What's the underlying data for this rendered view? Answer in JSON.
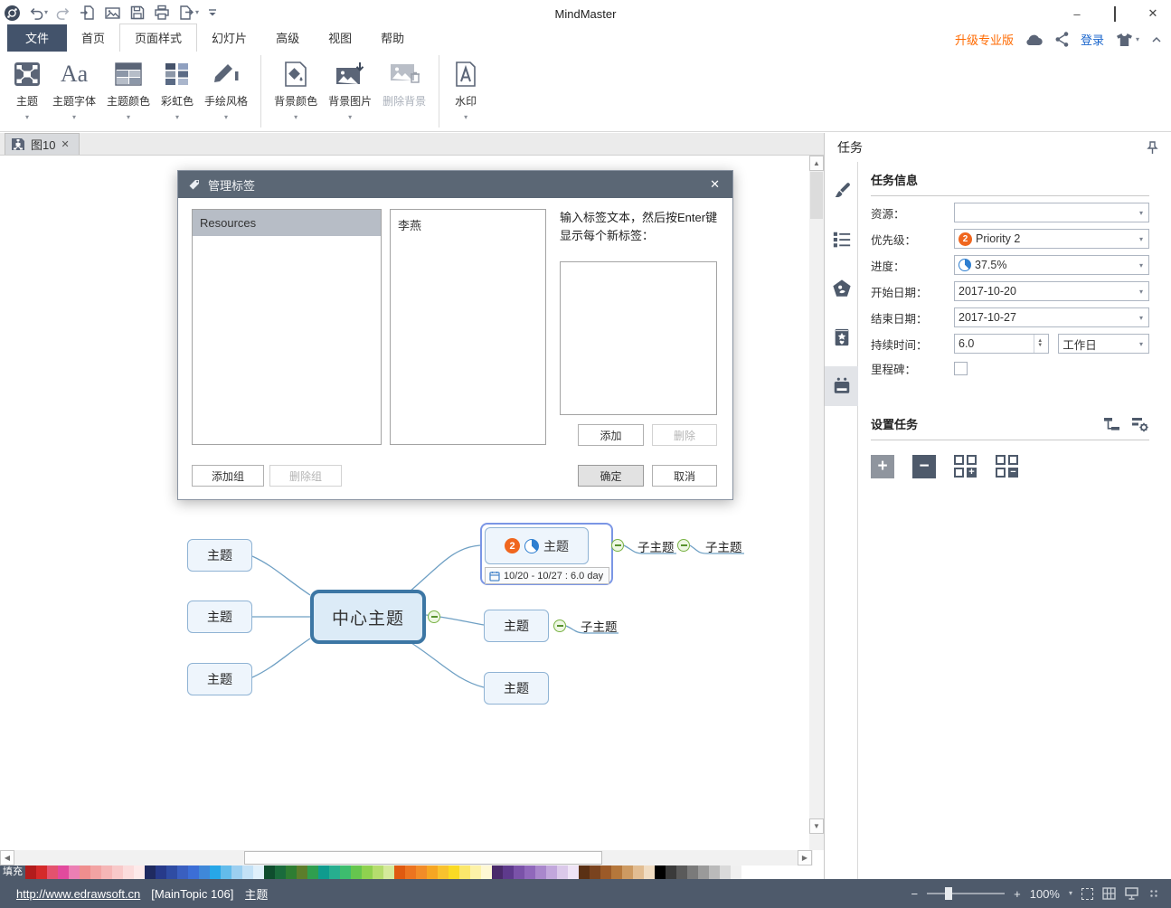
{
  "titlebar": {
    "title": "MindMaster"
  },
  "icons": {
    "caret_down": "▾",
    "close": "✕",
    "minimize": "–",
    "chevron_up_small": "▲",
    "chevron_down_small": "▼",
    "arrow_up": "▲",
    "arrow_down": "▼",
    "arrow_left": "◀",
    "arrow_right": "▶",
    "plus": "+",
    "minus": "−"
  },
  "ribbon": {
    "tabs": [
      {
        "label": "文件"
      },
      {
        "label": "首页"
      },
      {
        "label": "页面样式",
        "active": true
      },
      {
        "label": "幻灯片"
      },
      {
        "label": "高级"
      },
      {
        "label": "视图"
      },
      {
        "label": "帮助"
      }
    ],
    "upgrade_label": "升级专业版",
    "login_label": "登录",
    "groups": [
      {
        "buttons": [
          {
            "label": "主题"
          },
          {
            "label": "主题字体"
          },
          {
            "label": "主题颜色"
          },
          {
            "label": "彩虹色"
          },
          {
            "label": "手绘风格"
          }
        ]
      },
      {
        "buttons": [
          {
            "label": "背景颜色"
          },
          {
            "label": "背景图片"
          },
          {
            "label": "删除背景",
            "disabled": true
          }
        ]
      },
      {
        "buttons": [
          {
            "label": "水印"
          }
        ]
      }
    ]
  },
  "doc_tab": {
    "label": "图10"
  },
  "dialog": {
    "title": "管理标签",
    "groups_list": [
      "Resources"
    ],
    "tags_list": [
      "李燕"
    ],
    "hint": "输入标签文本，然后按Enter键显示每个新标签：",
    "buttons": {
      "add": "添加",
      "delete": "删除",
      "add_group": "添加组",
      "delete_group": "删除组",
      "ok": "确定",
      "cancel": "取消"
    }
  },
  "task_panel": {
    "title": "任务",
    "info_title": "任务信息",
    "fields": [
      {
        "label": "资源：",
        "value": ""
      },
      {
        "label": "优先级：",
        "value": "Priority 2",
        "badge": "2"
      },
      {
        "label": "进度：",
        "value": "37.5%"
      },
      {
        "label": "开始日期：",
        "value": "2017-10-20"
      },
      {
        "label": "结束日期：",
        "value": "2017-10-27"
      },
      {
        "label": "持续时间：",
        "value": "6.0",
        "unit": "工作日"
      },
      {
        "label": "里程碑：",
        "value": ""
      }
    ],
    "set_title": "设置任务"
  },
  "mindmap": {
    "central_label": "中心主题",
    "topic_label": "主题",
    "subtopic_label": "子主题",
    "selected": {
      "label": "主题",
      "priority": "2",
      "progress": "37.5%",
      "date": "10/20 - 10/27 : 6.0 day"
    }
  },
  "statusbar": {
    "url": "http://www.edrawsoft.cn",
    "node_ref": "[MainTopic 106]",
    "node_label": "主题",
    "zoom_level": "100%"
  },
  "palette": {
    "fill_label": "填充",
    "colors": [
      "#b21c1c",
      "#d42a2a",
      "#e4526e",
      "#e24a9d",
      "#ec7fb4",
      "#ef8e8e",
      "#f2a3a3",
      "#f5b6b6",
      "#f8c9c9",
      "#fbdcdc",
      "#fdeaea",
      "#1f2a60",
      "#273a8a",
      "#2f4ca3",
      "#3a5fc0",
      "#3c6ed6",
      "#3f88d9",
      "#27a7e8",
      "#63bceb",
      "#9ccff0",
      "#c3e1f6",
      "#e0f0fb",
      "#0f4d2e",
      "#1a6b3c",
      "#2e7d32",
      "#5c7d2b",
      "#2f9e4f",
      "#0f9b8e",
      "#27ae8f",
      "#3dbd6e",
      "#66c64e",
      "#8fd14f",
      "#b5dd6e",
      "#d5ea9b",
      "#e05a10",
      "#ec7420",
      "#f28c28",
      "#f6a623",
      "#f9c22e",
      "#fada24",
      "#fbe76b",
      "#fdf2a8",
      "#fef8d4",
      "#4a2a6b",
      "#5e3a8c",
      "#7a52a8",
      "#9068bb",
      "#a987cc",
      "#c2a7dc",
      "#dbc9ea",
      "#efe4f6",
      "#5a3014",
      "#7a431f",
      "#9c5a28",
      "#b5773b",
      "#cd9a62",
      "#e2bd92",
      "#f0dcc2",
      "#000000",
      "#3a3a3a",
      "#5a5a5a",
      "#7a7a7a",
      "#9a9a9a",
      "#bababa",
      "#dadada",
      "#f0f0f0"
    ]
  }
}
